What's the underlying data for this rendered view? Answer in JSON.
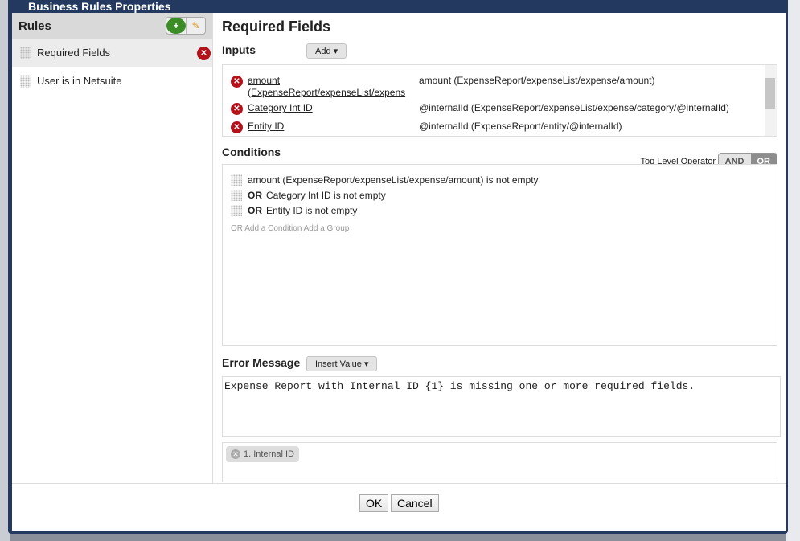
{
  "dialog": {
    "title": "Business Rules Properties"
  },
  "rules": {
    "header": "Rules",
    "items": [
      {
        "label": "Required Fields",
        "selected": true
      },
      {
        "label": "User is in Netsuite",
        "selected": false
      }
    ]
  },
  "main": {
    "title": "Required Fields",
    "inputs": {
      "label": "Inputs",
      "add_label": "Add ▾",
      "rows": [
        {
          "name": "amount (ExpenseReport/expenseList/expens",
          "value": "amount (ExpenseReport/expenseList/expense/amount)"
        },
        {
          "name": "Category Int ID",
          "value": "@internalId (ExpenseReport/expenseList/expense/category/@internalId)"
        },
        {
          "name": "Entity ID",
          "value": "@internalId (ExpenseReport/entity/@internalId)"
        }
      ]
    },
    "conditions": {
      "label": "Conditions",
      "operator_label": "Top Level Operator",
      "operator_options": [
        "AND",
        "OR"
      ],
      "operator_selected": "OR",
      "items": [
        {
          "op": "",
          "text": "amount (ExpenseReport/expenseList/expense/amount) is not empty"
        },
        {
          "op": "OR",
          "text": "Category Int ID is not empty"
        },
        {
          "op": "OR",
          "text": "Entity ID is not empty"
        }
      ],
      "add_prefix": "OR",
      "add_condition": "Add a Condition",
      "add_group": "Add a Group"
    },
    "error": {
      "label": "Error Message",
      "insert_label": "Insert Value ▾",
      "text": "Expense Report with Internal ID {1} is missing one or more required fields.",
      "chips": [
        "1. Internal ID"
      ]
    }
  },
  "footer": {
    "ok": "OK",
    "cancel": "Cancel"
  },
  "colors": {
    "frame": "#23395f",
    "remove": "#b3121a",
    "add": "#3b8c26"
  }
}
